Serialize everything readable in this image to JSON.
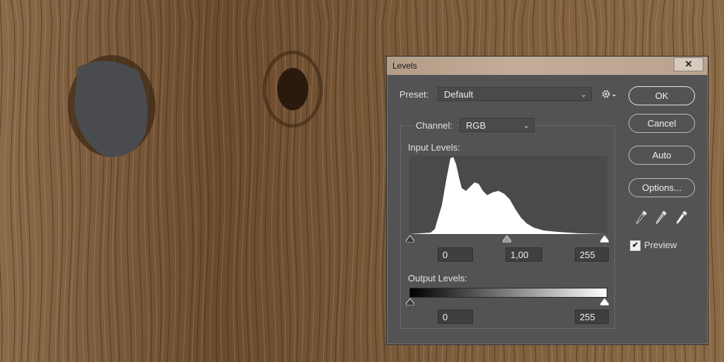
{
  "dialog": {
    "title": "Levels",
    "close_glyph": "✕",
    "preset": {
      "label": "Preset:",
      "value": "Default"
    },
    "channel": {
      "label": "Channel:",
      "value": "RGB"
    },
    "input_levels": {
      "label": "Input Levels:",
      "black": "0",
      "gamma": "1,00",
      "white": "255"
    },
    "output_levels": {
      "label": "Output Levels:",
      "black": "0",
      "white": "255"
    },
    "buttons": {
      "ok": "OK",
      "cancel": "Cancel",
      "auto": "Auto",
      "options": "Options..."
    },
    "preview": {
      "label": "Preview",
      "checked": true,
      "check_glyph": "✔"
    },
    "icons": [
      "gear-icon",
      "black-point-eyedropper-icon",
      "gray-point-eyedropper-icon",
      "white-point-eyedropper-icon"
    ]
  },
  "colors": {
    "dialog_bg": "#535353",
    "titlebar": "#c0aa95",
    "histogram_fill": "#ffffff",
    "wood": "#7a5a3a"
  }
}
